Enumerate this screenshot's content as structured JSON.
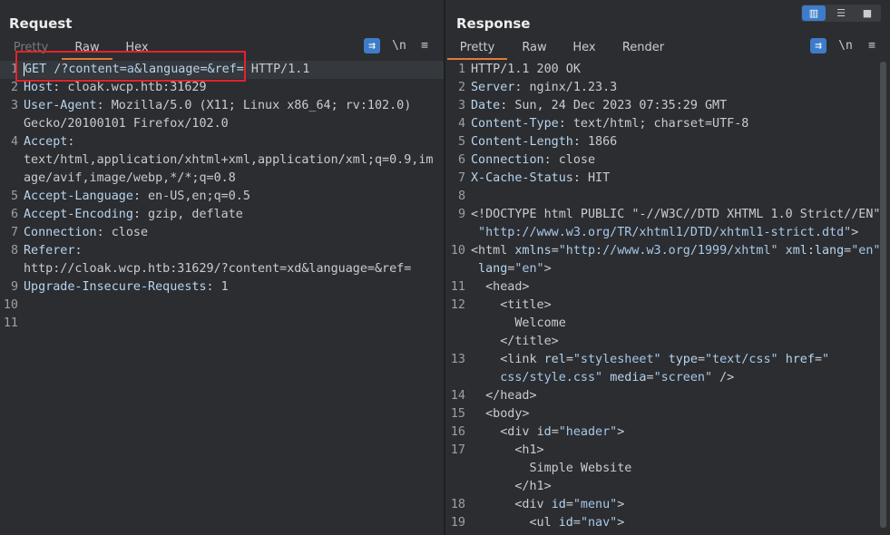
{
  "request": {
    "title": "Request",
    "tabs": [
      "Pretty",
      "Raw",
      "Hex"
    ],
    "active_tab": "Raw",
    "lines": [
      {
        "n": "1",
        "parts": [
          [
            "k",
            "GET /?content="
          ],
          [
            "s",
            "a"
          ],
          [
            "k",
            "&language=&ref="
          ],
          [
            "v",
            " HTTP/1.1"
          ]
        ]
      },
      {
        "n": "2",
        "parts": [
          [
            "k",
            "Host"
          ],
          [
            "v",
            ": cloak.wcp.htb:31629"
          ]
        ]
      },
      {
        "n": "3",
        "parts": [
          [
            "k",
            "User-Agent"
          ],
          [
            "v",
            ": Mozilla/5.0 (X11; Linux x86_64; rv:102.0)"
          ]
        ]
      },
      {
        "n": "",
        "parts": [
          [
            "v",
            "Gecko/20100101 Firefox/102.0"
          ]
        ]
      },
      {
        "n": "4",
        "parts": [
          [
            "k",
            "Accept"
          ],
          [
            "v",
            ":"
          ]
        ]
      },
      {
        "n": "",
        "parts": [
          [
            "v",
            "text/html,application/xhtml+xml,application/xml;q=0.9,im"
          ]
        ]
      },
      {
        "n": "",
        "parts": [
          [
            "v",
            "age/avif,image/webp,*/*;q=0.8"
          ]
        ]
      },
      {
        "n": "5",
        "parts": [
          [
            "k",
            "Accept-Language"
          ],
          [
            "v",
            ": en-US,en;q=0.5"
          ]
        ]
      },
      {
        "n": "6",
        "parts": [
          [
            "k",
            "Accept-Encoding"
          ],
          [
            "v",
            ": gzip, deflate"
          ]
        ]
      },
      {
        "n": "7",
        "parts": [
          [
            "k",
            "Connection"
          ],
          [
            "v",
            ": close"
          ]
        ]
      },
      {
        "n": "8",
        "parts": [
          [
            "k",
            "Referer"
          ],
          [
            "v",
            ":"
          ]
        ]
      },
      {
        "n": "",
        "parts": [
          [
            "v",
            "http://cloak.wcp.htb:31629/?content=xd&language=&ref="
          ]
        ]
      },
      {
        "n": "9",
        "parts": [
          [
            "k",
            "Upgrade-Insecure-Requests"
          ],
          [
            "v",
            ": 1"
          ]
        ]
      },
      {
        "n": "10",
        "parts": []
      },
      {
        "n": "11",
        "parts": []
      }
    ],
    "wrap_icon": "wrap-lines-icon",
    "newline_label": "\\n",
    "menu_icon": "hamburger-menu-icon"
  },
  "response": {
    "title": "Response",
    "tabs": [
      "Pretty",
      "Raw",
      "Hex",
      "Render"
    ],
    "active_tab": "Pretty",
    "lines": [
      {
        "n": "1",
        "parts": [
          [
            "v",
            "HTTP/1.1 200 OK"
          ]
        ]
      },
      {
        "n": "2",
        "parts": [
          [
            "k",
            "Server"
          ],
          [
            "v",
            ": nginx/1.23.3"
          ]
        ]
      },
      {
        "n": "3",
        "parts": [
          [
            "k",
            "Date"
          ],
          [
            "v",
            ": Sun, 24 Dec 2023 07:35:29 GMT"
          ]
        ]
      },
      {
        "n": "4",
        "parts": [
          [
            "k",
            "Content-Type"
          ],
          [
            "v",
            ": text/html; charset=UTF-8"
          ]
        ]
      },
      {
        "n": "5",
        "parts": [
          [
            "k",
            "Content-Length"
          ],
          [
            "v",
            ": 1866"
          ]
        ]
      },
      {
        "n": "6",
        "parts": [
          [
            "k",
            "Connection"
          ],
          [
            "v",
            ": close"
          ]
        ]
      },
      {
        "n": "7",
        "parts": [
          [
            "k",
            "X-Cache-Status"
          ],
          [
            "v",
            ": HIT"
          ]
        ]
      },
      {
        "n": "8",
        "parts": []
      },
      {
        "n": "9",
        "parts": [
          [
            "v",
            "<!DOCTYPE html PUBLIC \"-//W3C//DTD XHTML 1.0 Strict//EN\""
          ]
        ]
      },
      {
        "n": "",
        "parts": [
          [
            "s",
            " \"http://www.w3.org/TR/xhtml1/DTD/xhtml1-strict.dtd\""
          ],
          [
            "v",
            ">"
          ]
        ]
      },
      {
        "n": "10",
        "parts": [
          [
            "v",
            "<html "
          ],
          [
            "k",
            "xmlns"
          ],
          [
            "v",
            "="
          ],
          [
            "s",
            "\"http://www.w3.org/1999/xhtml\""
          ],
          [
            "v",
            " "
          ],
          [
            "k",
            "xml:lang"
          ],
          [
            "v",
            "="
          ],
          [
            "s",
            "\"en\""
          ]
        ]
      },
      {
        "n": "",
        "parts": [
          [
            "v",
            " "
          ],
          [
            "k",
            "lang"
          ],
          [
            "v",
            "="
          ],
          [
            "s",
            "\"en\""
          ],
          [
            "v",
            ">"
          ]
        ]
      },
      {
        "n": "11",
        "parts": [
          [
            "v",
            "  <head>"
          ]
        ]
      },
      {
        "n": "12",
        "parts": [
          [
            "v",
            "    <title>"
          ]
        ]
      },
      {
        "n": "",
        "parts": [
          [
            "v",
            "      Welcome"
          ]
        ]
      },
      {
        "n": "",
        "parts": [
          [
            "v",
            "    </title>"
          ]
        ]
      },
      {
        "n": "13",
        "parts": [
          [
            "v",
            "    <link "
          ],
          [
            "k",
            "rel"
          ],
          [
            "v",
            "="
          ],
          [
            "s",
            "\"stylesheet\""
          ],
          [
            "v",
            " "
          ],
          [
            "k",
            "type"
          ],
          [
            "v",
            "="
          ],
          [
            "s",
            "\"text/css\""
          ],
          [
            "v",
            " "
          ],
          [
            "k",
            "href"
          ],
          [
            "v",
            "="
          ],
          [
            "s",
            "\""
          ]
        ]
      },
      {
        "n": "",
        "parts": [
          [
            "s",
            "    css/style.css\""
          ],
          [
            "v",
            " "
          ],
          [
            "k",
            "media"
          ],
          [
            "v",
            "="
          ],
          [
            "s",
            "\"screen\""
          ],
          [
            "v",
            " />"
          ]
        ]
      },
      {
        "n": "14",
        "parts": [
          [
            "v",
            "  </head>"
          ]
        ]
      },
      {
        "n": "15",
        "parts": [
          [
            "v",
            "  <body>"
          ]
        ]
      },
      {
        "n": "16",
        "parts": [
          [
            "v",
            "    <div "
          ],
          [
            "k",
            "id"
          ],
          [
            "v",
            "="
          ],
          [
            "s",
            "\"header\""
          ],
          [
            "v",
            ">"
          ]
        ]
      },
      {
        "n": "17",
        "parts": [
          [
            "v",
            "      <h1>"
          ]
        ]
      },
      {
        "n": "",
        "parts": [
          [
            "v",
            "        Simple Website"
          ]
        ]
      },
      {
        "n": "",
        "parts": [
          [
            "v",
            "      </h1>"
          ]
        ]
      },
      {
        "n": "18",
        "parts": [
          [
            "v",
            "      <div "
          ],
          [
            "k",
            "id"
          ],
          [
            "v",
            "="
          ],
          [
            "s",
            "\"menu\""
          ],
          [
            "v",
            ">"
          ]
        ]
      },
      {
        "n": "19",
        "parts": [
          [
            "v",
            "        <ul "
          ],
          [
            "k",
            "id"
          ],
          [
            "v",
            "="
          ],
          [
            "s",
            "\"nav\""
          ],
          [
            "v",
            ">"
          ]
        ]
      }
    ],
    "wrap_icon": "wrap-lines-icon",
    "newline_label": "\\n",
    "menu_icon": "hamburger-menu-icon"
  },
  "layout_buttons": [
    "side-by-side-icon",
    "horizontal-split-icon",
    "single-pane-icon"
  ],
  "colors": {
    "accent": "#e07b3a",
    "highlight_box": "#e5222a",
    "toggle_blue": "#3d7cc9"
  }
}
